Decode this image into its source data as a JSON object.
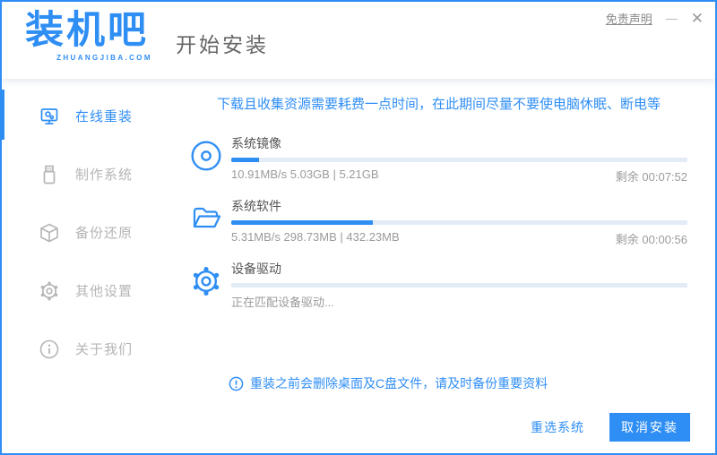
{
  "window_controls": {
    "disclaimer_label": "免责声明",
    "minimize_glyph": "—",
    "close_glyph": "✕"
  },
  "header": {
    "logo_text": "装机吧",
    "logo_subtext": "ZHUANGJIBA.COM",
    "page_title": "开始安装"
  },
  "sidebar": {
    "items": [
      {
        "label": "在线重装",
        "icon": "monitor-icon",
        "active": true
      },
      {
        "label": "制作系统",
        "icon": "usb-icon",
        "active": false
      },
      {
        "label": "备份还原",
        "icon": "cube-icon",
        "active": false
      },
      {
        "label": "其他设置",
        "icon": "gear-icon",
        "active": false
      },
      {
        "label": "关于我们",
        "icon": "info-icon",
        "active": false
      }
    ]
  },
  "main": {
    "warning": "下载且收集资源需要耗费一点时间，在此期间尽量不要使电脑休眠、断电等",
    "tasks": [
      {
        "name": "系统镜像",
        "icon": "disc-icon",
        "progress_percent": 6,
        "stats": "10.91MB/s 5.03GB | 5.21GB",
        "remaining": "剩余 00:07:52"
      },
      {
        "name": "系统软件",
        "icon": "folder-icon",
        "progress_percent": 31,
        "stats": "5.31MB/s 298.73MB | 432.23MB",
        "remaining": "剩余 00:00:56"
      },
      {
        "name": "设备驱动",
        "icon": "gear-icon",
        "progress_percent": 0,
        "stats": "正在匹配设备驱动...",
        "remaining": ""
      }
    ],
    "notice": "重装之前会删除桌面及C盘文件，请及时备份重要资料"
  },
  "footer": {
    "reselect_label": "重选系统",
    "cancel_label": "取消安装"
  },
  "colors": {
    "accent": "#2f8ef4",
    "inactive_gray": "#b5b5b5",
    "bar_track": "#e2ebf6",
    "text_gray": "#9b9b9b"
  }
}
